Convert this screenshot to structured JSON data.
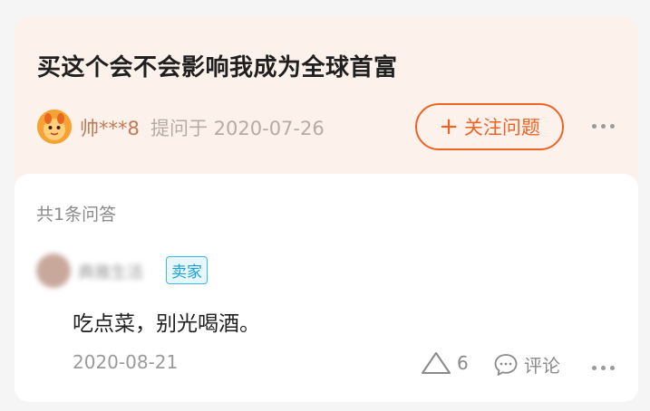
{
  "question": {
    "title": "买这个会不会影响我成为全球首富",
    "asker": "帅***8",
    "asked_on": "提问于 2020-07-26",
    "follow_label": "关注问题",
    "follow_plus": "+"
  },
  "answers": {
    "count_label": "共1条问答",
    "items": [
      {
        "author": "典雅生活",
        "badge": "卖家",
        "text": "吃点菜，别光喝酒。",
        "date": "2020-08-21",
        "likes": "6",
        "comment_label": "评论"
      }
    ]
  },
  "colors": {
    "accent": "#f06323",
    "question_bg": "#fdf1ec",
    "badge_blue": "#1aa1d9"
  },
  "icons": {
    "asker_avatar": "orange-mascot-avatar",
    "like": "triangle-outline-icon",
    "comment": "speech-bubble-icon",
    "more": "three-dots-icon"
  }
}
